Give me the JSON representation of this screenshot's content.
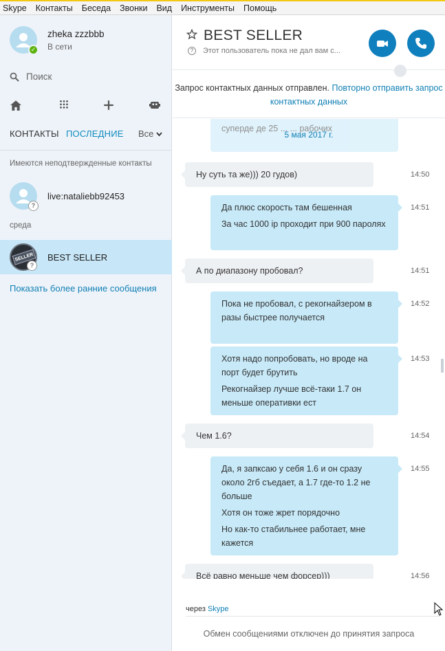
{
  "menu": [
    "Skype",
    "Контакты",
    "Беседа",
    "Звонки",
    "Вид",
    "Инструменты",
    "Помощь"
  ],
  "profile": {
    "name": "zheka zzzbbb",
    "status": "В сети"
  },
  "search": {
    "label": "Поиск"
  },
  "toolbar_icons": [
    "home-icon",
    "dialpad-icon",
    "add-icon",
    "bot-icon"
  ],
  "tabs": {
    "contacts": "КОНТАКТЫ",
    "recent": "ПОСЛЕДНИЕ",
    "filter": "Все"
  },
  "sections": {
    "unconfirmed": "Имеются неподтвержденные контакты",
    "wednesday": "среда"
  },
  "contacts": [
    {
      "name": "live:nataliebb92453"
    },
    {
      "name": "BEST SELLER"
    }
  ],
  "show_earlier": "Показать более ранние сообщения",
  "conversation": {
    "title": "BEST SELLER",
    "subtitle": "Этот пользователь пока не дал вам с...",
    "notice_text": "Запрос контактных данных отправлен.",
    "notice_link": "Повторно отправить запрос контактных данных",
    "partial_top": "суперде де 25 ... ... рабочих",
    "date_separator": "5 мая 2017 г.",
    "messages": [
      {
        "dir": "in",
        "time": "14:50",
        "lines": [
          "Ну суть та же))) 20 гудов)"
        ]
      },
      {
        "dir": "out",
        "time": "14:51",
        "lines": [
          "Да плюс скорость там бешенная",
          "За час 1000 ip проходит при 900 паролях"
        ]
      },
      {
        "dir": "in",
        "time": "14:51",
        "lines": [
          "А по диапазону пробовал?"
        ]
      },
      {
        "dir": "out",
        "time": "14:52",
        "lines": [
          "Пока не пробовал, с рекогнайзером в разы быстрее получается"
        ]
      },
      {
        "dir": "out",
        "time": "14:53",
        "lines": [
          "Хотя надо попробовать, но вроде на порт будет брутить",
          "Рекогнайзер лучше всё-таки 1.7 он меньше оперативки ест"
        ]
      },
      {
        "dir": "in",
        "time": "14:54",
        "lines": [
          "Чем 1.6?"
        ]
      },
      {
        "dir": "out",
        "time": "14:55",
        "lines": [
          "Да, я запксаю у себя 1.6 и он сразу около 2гб съедает, а 1.7 где-то 1.2 не больше",
          "Хотя он тоже жрет порядочно",
          "Но как-то стабильнее работает, мне кажется"
        ]
      },
      {
        "dir": "in",
        "time": "14:56",
        "lines": [
          "Всё равно меньше чем форсер)))"
        ]
      }
    ],
    "via_label": "через",
    "via_link": "Skype",
    "footer": "Обмен сообщениями отключен до принятия запроса"
  },
  "colors": {
    "accent": "#0f7fbd",
    "selected": "#c7e6f7",
    "bubble_out": "#c7e9f8",
    "bubble_in": "#eef1f4"
  }
}
